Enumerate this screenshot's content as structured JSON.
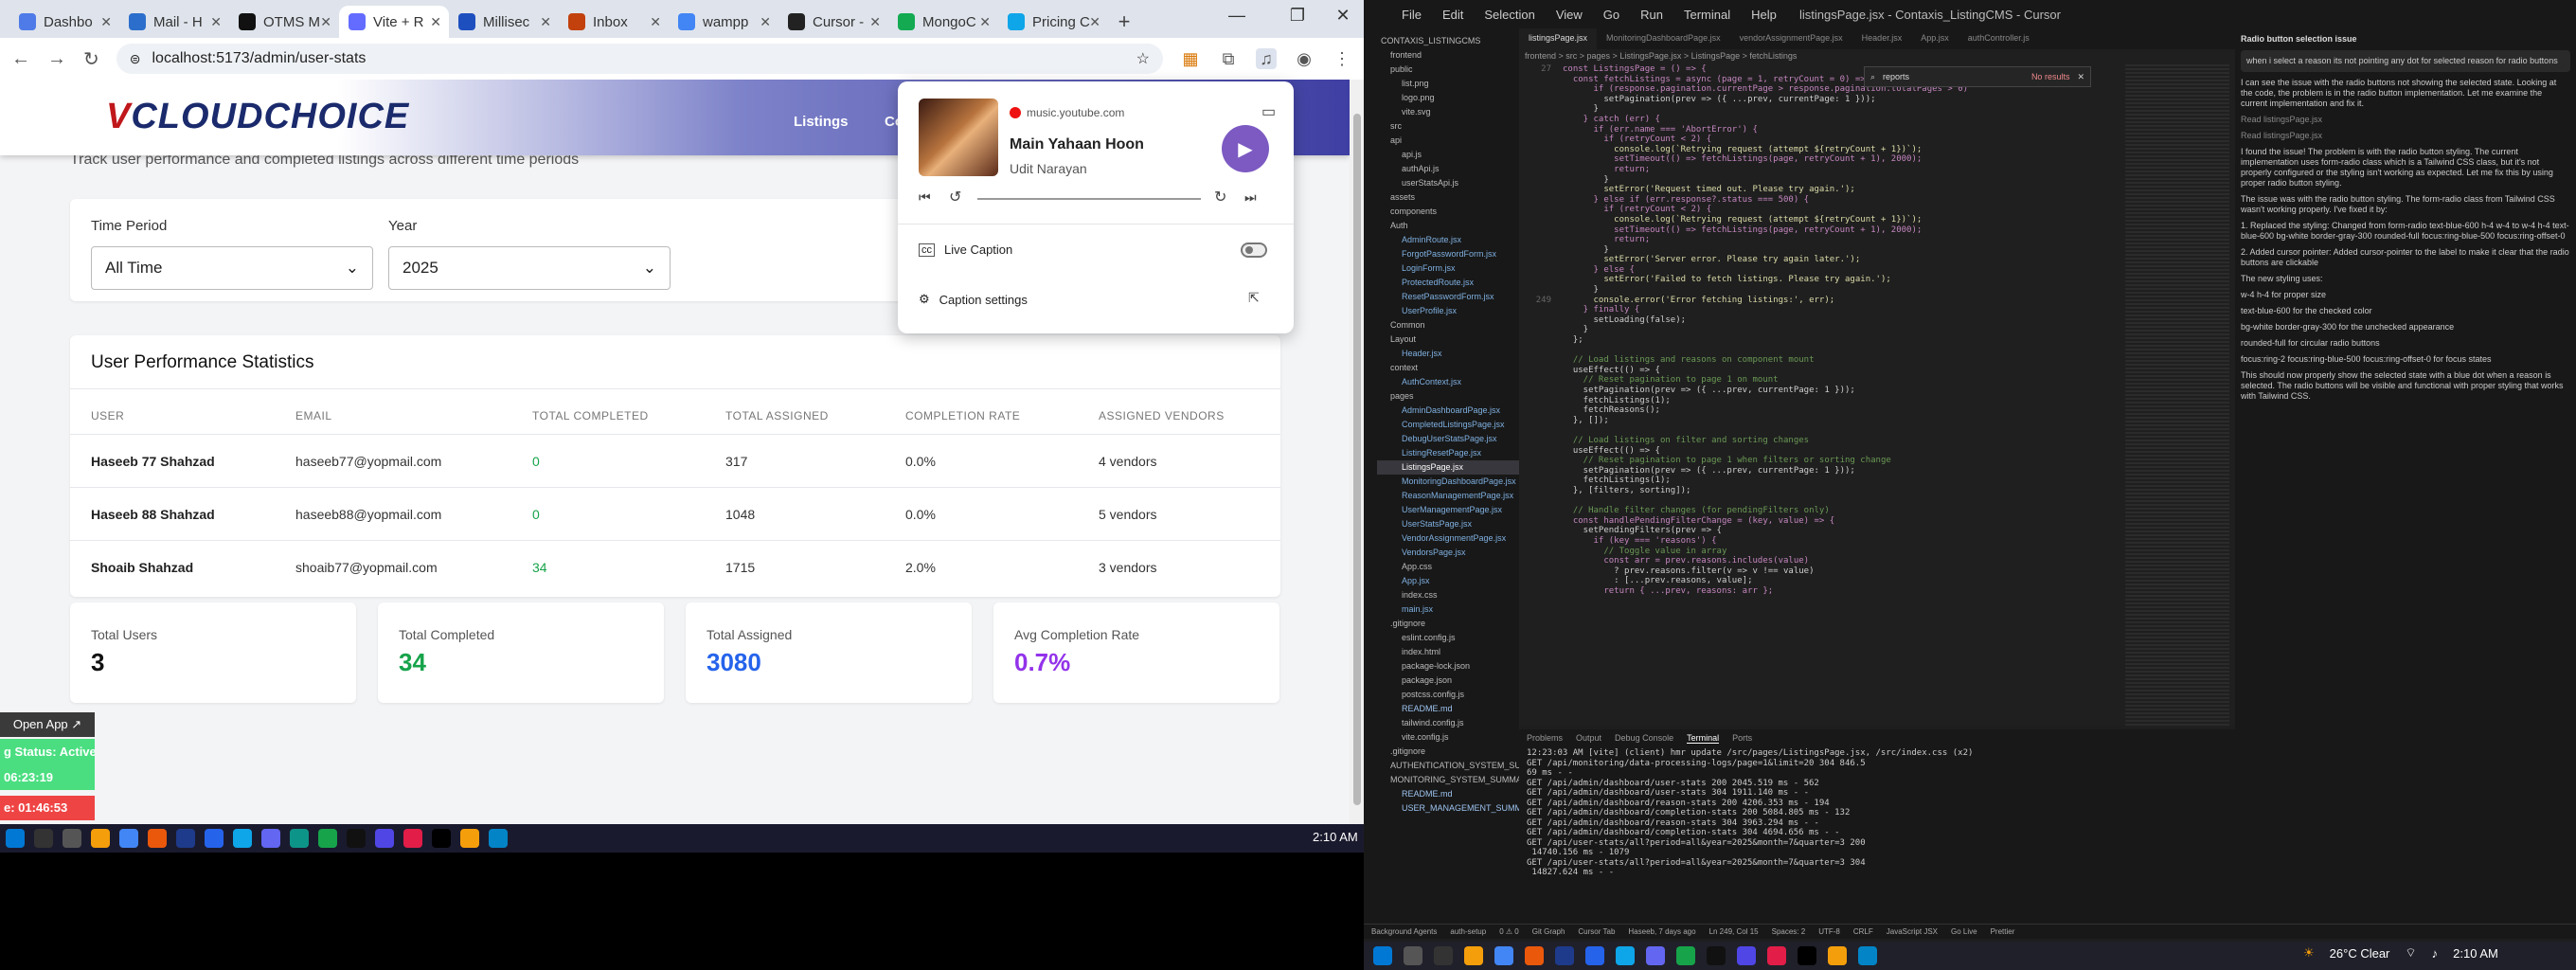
{
  "browser": {
    "tabs": [
      {
        "label": "Dashbo",
        "color": "#4f7be8"
      },
      {
        "label": "Mail - H",
        "color": "#2c6ecb"
      },
      {
        "label": "OTMS M",
        "color": "#111111"
      },
      {
        "label": "Vite + R",
        "color": "#646cff"
      },
      {
        "label": "Millisec",
        "color": "#1e4fbf"
      },
      {
        "label": "Inbox",
        "color": "#c2410c"
      },
      {
        "label": "wampp",
        "color": "#4285f4"
      },
      {
        "label": "Cursor -",
        "color": "#222222"
      },
      {
        "label": "MongoC",
        "color": "#13aa52"
      },
      {
        "label": "Pricing C",
        "color": "#0ea5e9"
      }
    ],
    "url": "localhost:5173/admin/user-stats"
  },
  "app": {
    "logo_v": "V",
    "logo_rest": "CLOUDCHOICE",
    "nav": [
      "Listings",
      "Co"
    ],
    "subtitle": "Track user performance and completed listings across different time periods",
    "filters": {
      "time_period_label": "Time Period",
      "time_period_value": "All Time",
      "year_label": "Year",
      "year_value": "2025"
    },
    "table": {
      "title": "User Performance Statistics",
      "headers": [
        "USER",
        "EMAIL",
        "TOTAL COMPLETED",
        "TOTAL ASSIGNED",
        "COMPLETION RATE",
        "ASSIGNED VENDORS"
      ],
      "rows": [
        {
          "user": "Haseeb 77 Shahzad",
          "email": "haseeb77@yopmail.com",
          "completed": "0",
          "assigned": "317",
          "rate": "0.0%",
          "vendors": "4 vendors"
        },
        {
          "user": "Haseeb 88 Shahzad",
          "email": "haseeb88@yopmail.com",
          "completed": "0",
          "assigned": "1048",
          "rate": "0.0%",
          "vendors": "5 vendors"
        },
        {
          "user": "Shoaib Shahzad",
          "email": "shoaib77@yopmail.com",
          "completed": "34",
          "assigned": "1715",
          "rate": "2.0%",
          "vendors": "3 vendors"
        }
      ]
    },
    "stats": [
      {
        "label": "Total Users",
        "value": "3",
        "color": "#111111"
      },
      {
        "label": "Total Completed",
        "value": "34",
        "color": "#16a34a"
      },
      {
        "label": "Total Assigned",
        "value": "3080",
        "color": "#2563eb"
      },
      {
        "label": "Avg Completion Rate",
        "value": "0.7%",
        "color": "#9333ea"
      }
    ]
  },
  "media": {
    "source": "music.youtube.com",
    "title": "Main Yahaan Hoon",
    "artist": "Udit Narayan",
    "live_caption": "Live Caption",
    "caption_settings": "Caption settings"
  },
  "overlay": {
    "open_app": "Open App ↗",
    "status": "g Status: Active",
    "time1": "06:23:19",
    "time2": "e: 01:46:53"
  },
  "taskbar_left": {
    "clock": "2:10 AM"
  },
  "vscode": {
    "menu": [
      "File",
      "Edit",
      "Selection",
      "View",
      "Go",
      "Run",
      "Terminal",
      "Help"
    ],
    "title": "listingsPage.jsx - Contaxis_ListingCMS - Cursor",
    "tabs": [
      "listingsPage.jsx",
      "MonitoringDashboardPage.jsx",
      "vendorAssignmentPage.jsx",
      "Header.jsx",
      "App.jsx",
      "authController.js"
    ],
    "breadcrumb": "frontend > src > pages > ListingsPage.jsx > ListingsPage > fetchListings",
    "find_text": "reports",
    "find_result": "No results",
    "explorer": [
      "CONTAXIS_LISTINGCMS",
      "frontend",
      "public",
      "list.png",
      "logo.png",
      "vite.svg",
      "src",
      "api",
      "api.js",
      "authApi.js",
      "userStatsApi.js",
      "assets",
      "components",
      "Auth",
      "AdminRoute.jsx",
      "ForgotPasswordForm.jsx",
      "LoginForm.jsx",
      "ProtectedRoute.jsx",
      "ResetPasswordForm.jsx",
      "UserProfile.jsx",
      "Common",
      "Layout",
      "Header.jsx",
      "context",
      "AuthContext.jsx",
      "pages",
      "AdminDashboardPage.jsx",
      "CompletedListingsPage.jsx",
      "DebugUserStatsPage.jsx",
      "ListingResetPage.jsx",
      "ListingsPage.jsx",
      "MonitoringDashboardPage.jsx",
      "ReasonManagementPage.jsx",
      "UserManagementPage.jsx",
      "UserStatsPage.jsx",
      "VendorAssignmentPage.jsx",
      "VendorsPage.jsx",
      "App.css",
      "App.jsx",
      "index.css",
      "main.jsx",
      ".gitignore",
      "eslint.config.js",
      "index.html",
      "package-lock.json",
      "package.json",
      "postcss.config.js",
      "README.md",
      "tailwind.config.js",
      "vite.config.js",
      ".gitignore",
      "AUTHENTICATION_SYSTEM_SUMMA...",
      "MONITORING_SYSTEM_SUMMARY...",
      "README.md",
      "USER_MANAGEMENT_SUMMARY.md"
    ],
    "code": [
      {
        "n": "27",
        "t": "const ListingsPage = () => {"
      },
      {
        "n": "",
        "t": "  const fetchListings = async (page = 1, retryCount = 0) => {"
      },
      {
        "n": "",
        "t": "      if (response.pagination.currentPage > response.pagination.totalPages > 0)"
      },
      {
        "n": "",
        "t": "        setPagination(prev => ({ ...prev, currentPage: 1 }));"
      },
      {
        "n": "",
        "t": "      }"
      },
      {
        "n": "",
        "t": "    } catch (err) {"
      },
      {
        "n": "",
        "t": "      if (err.name === 'AbortError') {"
      },
      {
        "n": "",
        "t": "        if (retryCount < 2) {"
      },
      {
        "n": "",
        "t": "          console.log(`Retrying request (attempt ${retryCount + 1})`);"
      },
      {
        "n": "",
        "t": "          setTimeout(() => fetchListings(page, retryCount + 1), 2000);"
      },
      {
        "n": "",
        "t": "          return;"
      },
      {
        "n": "",
        "t": "        }"
      },
      {
        "n": "",
        "t": "        setError('Request timed out. Please try again.');"
      },
      {
        "n": "",
        "t": "      } else if (err.response?.status === 500) {"
      },
      {
        "n": "",
        "t": "        if (retryCount < 2) {"
      },
      {
        "n": "",
        "t": "          console.log(`Retrying request (attempt ${retryCount + 1})`);"
      },
      {
        "n": "",
        "t": "          setTimeout(() => fetchListings(page, retryCount + 1), 2000);"
      },
      {
        "n": "",
        "t": "          return;"
      },
      {
        "n": "",
        "t": "        }"
      },
      {
        "n": "",
        "t": "        setError('Server error. Please try again later.');"
      },
      {
        "n": "",
        "t": "      } else {"
      },
      {
        "n": "",
        "t": "        setError('Failed to fetch listings. Please try again.');"
      },
      {
        "n": "",
        "t": "      }"
      },
      {
        "n": "249",
        "t": "      console.error('Error fetching listings:', err);"
      },
      {
        "n": "",
        "t": "    } finally {"
      },
      {
        "n": "",
        "t": "      setLoading(false);"
      },
      {
        "n": "",
        "t": "    }"
      },
      {
        "n": "",
        "t": "  };"
      },
      {
        "n": "",
        "t": ""
      },
      {
        "n": "",
        "t": "  // Load listings and reasons on component mount"
      },
      {
        "n": "",
        "t": "  useEffect(() => {"
      },
      {
        "n": "",
        "t": "    // Reset pagination to page 1 on mount"
      },
      {
        "n": "",
        "t": "    setPagination(prev => ({ ...prev, currentPage: 1 }));"
      },
      {
        "n": "",
        "t": "    fetchListings(1);"
      },
      {
        "n": "",
        "t": "    fetchReasons();"
      },
      {
        "n": "",
        "t": "  }, []);"
      },
      {
        "n": "",
        "t": ""
      },
      {
        "n": "",
        "t": "  // Load listings on filter and sorting changes"
      },
      {
        "n": "",
        "t": "  useEffect(() => {"
      },
      {
        "n": "",
        "t": "    // Reset pagination to page 1 when filters or sorting change"
      },
      {
        "n": "",
        "t": "    setPagination(prev => ({ ...prev, currentPage: 1 }));"
      },
      {
        "n": "",
        "t": "    fetchListings(1);"
      },
      {
        "n": "",
        "t": "  }, [filters, sorting]);"
      },
      {
        "n": "",
        "t": ""
      },
      {
        "n": "",
        "t": "  // Handle filter changes (for pendingFilters only)"
      },
      {
        "n": "",
        "t": "  const handlePendingFilterChange = (key, value) => {"
      },
      {
        "n": "",
        "t": "    setPendingFilters(prev => {"
      },
      {
        "n": "",
        "t": "      if (key === 'reasons') {"
      },
      {
        "n": "",
        "t": "        // Toggle value in array"
      },
      {
        "n": "",
        "t": "        const arr = prev.reasons.includes(value)"
      },
      {
        "n": "",
        "t": "          ? prev.reasons.filter(v => v !== value)"
      },
      {
        "n": "",
        "t": "          : [...prev.reasons, value];"
      },
      {
        "n": "",
        "t": "        return { ...prev, reasons: arr };"
      }
    ],
    "panel_tabs": [
      "Problems",
      "Output",
      "Debug Console",
      "Terminal",
      "Ports"
    ],
    "terminal": [
      "12:23:03 AM [vite] (client) hmr update /src/pages/ListingsPage.jsx, /src/index.css (x2)",
      "",
      "GET /api/monitoring/data-processing-logs/page=1&limit=20 304 846.5",
      "69 ms - -",
      "GET /api/admin/dashboard/user-stats 200 2045.519 ms - 562",
      "GET /api/admin/dashboard/user-stats 304 1911.140 ms - -",
      "GET /api/admin/dashboard/reason-stats 200 4206.353 ms - 194",
      "GET /api/admin/dashboard/completion-stats 200 5084.805 ms - 132",
      "GET /api/admin/dashboard/reason-stats 304 3963.294 ms - -",
      "GET /api/admin/dashboard/completion-stats 304 4694.656 ms - -",
      "GET /api/user-stats/all?period=all&year=2025&month=7&quarter=3 200",
      " 14740.156 ms - 1079",
      "GET /api/user-stats/all?period=all&year=2025&month=7&quarter=3 304",
      " 14827.624 ms - -"
    ],
    "chat_title": "Radio button selection issue",
    "chat": [
      "when i select a reason its not pointing any dot for selected reason for radio buttons",
      "I can see the issue with the radio buttons not showing the selected state. Looking at the code, the problem is in the radio button implementation. Let me examine the current implementation and fix it.",
      "Read listingsPage.jsx",
      "Read listingsPage.jsx",
      "I found the issue! The problem is with the radio button styling. The current implementation uses form-radio class which is a Tailwind CSS class, but it's not properly configured or the styling isn't working as expected. Let me fix this by using proper radio button styling.",
      "The issue was with the radio button styling. The form-radio class from Tailwind CSS wasn't working properly. I've fixed it by:",
      "1. Replaced the styling: Changed from form-radio text-blue-600 h-4 w-4 to w-4 h-4 text-blue-600 bg-white border-gray-300 rounded-full focus:ring-blue-500 focus:ring-offset-0",
      "2. Added cursor pointer: Added cursor-pointer to the label to make it clear that the radio buttons are clickable",
      "The new styling uses:",
      "w-4 h-4 for proper size",
      "text-blue-600 for the checked color",
      "bg-white border-gray-300 for the unchecked appearance",
      "rounded-full for circular radio buttons",
      "focus:ring-2 focus:ring-blue-500 focus:ring-offset-0 for focus states",
      "This should now properly show the selected state with a blue dot when a reason is selected. The radio buttons will be visible and functional with proper styling that works with Tailwind CSS."
    ],
    "status_items": [
      "Background Agents",
      "auth-setup",
      "0 ⚠ 0",
      "Git Graph",
      "Cursor Tab",
      "Haseeb, 7 days ago",
      "Ln 249, Col 15",
      "Spaces: 2",
      "UTF-8",
      "CRLF",
      "JavaScript JSX",
      "Go Live",
      "Prettier"
    ]
  },
  "taskbar_right": {
    "weather": "26°C  Clear",
    "clock": "2:10 AM"
  }
}
